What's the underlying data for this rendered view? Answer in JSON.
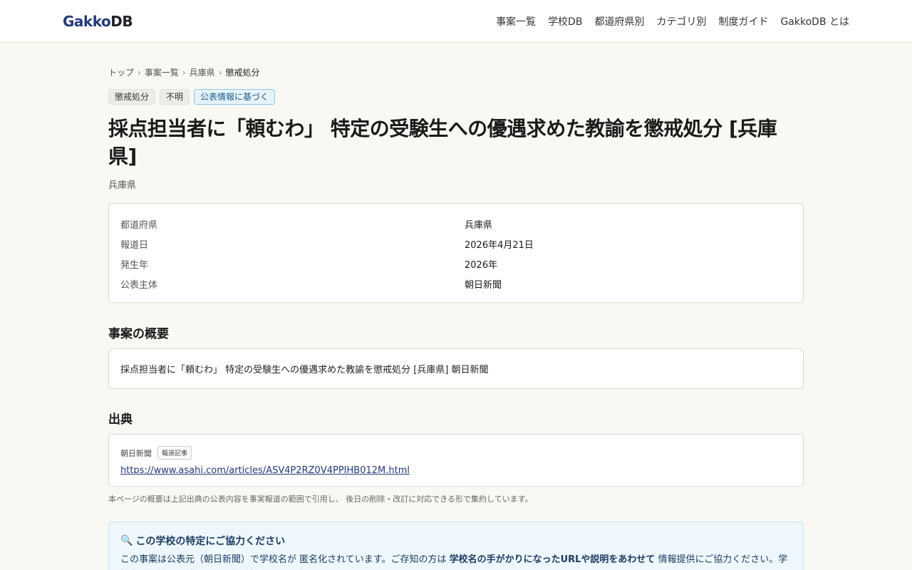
{
  "header": {
    "logo_a": "Gakko",
    "logo_b": "DB",
    "nav": [
      "事案一覧",
      "学校DB",
      "都道府県別",
      "カテゴリ別",
      "制度ガイド",
      "GakkoDB とは"
    ]
  },
  "breadcrumb": [
    "トップ",
    "事案一覧",
    "兵庫県",
    "懲戒処分"
  ],
  "tags": [
    "懲戒処分",
    "不明",
    "公表情報に基づく"
  ],
  "title": "採点担当者に「頼むわ」 特定の受験生への優遇求めた教諭を懲戒処分 [兵庫県]",
  "prefecture_sub": "兵庫県",
  "meta": [
    {
      "key": "都道府県",
      "value": "兵庫県"
    },
    {
      "key": "報道日",
      "value": "2026年4月21日"
    },
    {
      "key": "発生年",
      "value": "2026年"
    },
    {
      "key": "公表主体",
      "value": "朝日新聞"
    }
  ],
  "summary": {
    "heading": "事案の概要",
    "text": "採点担当者に「頼むわ」 特定の受験生への優遇求めた教諭を懲戒処分 [兵庫県] 朝日新聞"
  },
  "source": {
    "heading": "出典",
    "publisher": "朝日新聞",
    "badge": "報道記事",
    "url": "https://www.asahi.com/articles/ASV4P2RZ0V4PPIHB012M.html"
  },
  "disclaimer": "本ページの概要は上記出典の公表内容を事実報道の範囲で引用し、 後日の削除・改訂に対応できる形で集約しています。",
  "help": {
    "icon": "magnifier-icon",
    "icon_glyph": "🔍",
    "title": "この学校の特定にご協力ください",
    "text_1": "この事案は公表元（朝日新聞）で学校名が 匿名化されています。ご存知の方は ",
    "text_bold": "学校名の手がかりになったURLや説明をあわせて",
    "text_2": " 情報提供にご協力ください。学校名は保護者・読者からの投稿情報として 扱います。"
  }
}
